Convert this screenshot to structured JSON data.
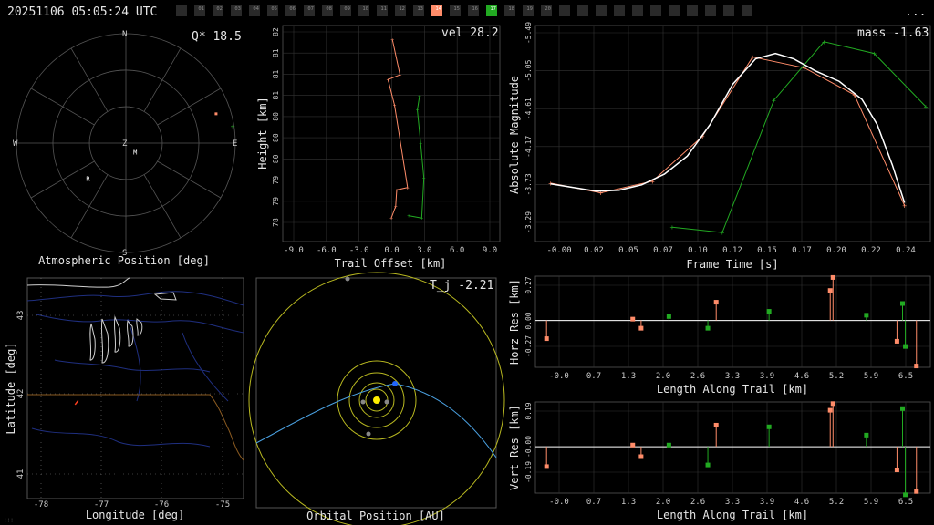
{
  "header": {
    "timestamp": "20251106 05:05:24 UTC",
    "menu_label": "...",
    "stations": [
      {
        "label": "",
        "state": "off"
      },
      {
        "label": "01",
        "state": "off"
      },
      {
        "label": "02",
        "state": "off"
      },
      {
        "label": "03",
        "state": "off"
      },
      {
        "label": "04",
        "state": "off"
      },
      {
        "label": "05",
        "state": "off"
      },
      {
        "label": "06",
        "state": "off"
      },
      {
        "label": "07",
        "state": "off"
      },
      {
        "label": "08",
        "state": "off"
      },
      {
        "label": "09",
        "state": "off"
      },
      {
        "label": "10",
        "state": "off"
      },
      {
        "label": "11",
        "state": "off"
      },
      {
        "label": "12",
        "state": "off"
      },
      {
        "label": "13",
        "state": "off"
      },
      {
        "label": "14",
        "state": "active-orange"
      },
      {
        "label": "15",
        "state": "off"
      },
      {
        "label": "16",
        "state": "off"
      },
      {
        "label": "17",
        "state": "active-green"
      },
      {
        "label": "18",
        "state": "off"
      },
      {
        "label": "19",
        "state": "off"
      },
      {
        "label": "20",
        "state": "off"
      },
      {
        "label": "",
        "state": "off"
      },
      {
        "label": "",
        "state": "off"
      },
      {
        "label": "",
        "state": "off"
      },
      {
        "label": "",
        "state": "off"
      },
      {
        "label": "",
        "state": "off"
      },
      {
        "label": "",
        "state": "off"
      },
      {
        "label": "",
        "state": "off"
      },
      {
        "label": "",
        "state": "off"
      },
      {
        "label": "",
        "state": "off"
      },
      {
        "label": "",
        "state": "off"
      },
      {
        "label": "",
        "state": "off"
      }
    ]
  },
  "colors": {
    "orange": "#ff8c69",
    "green": "#22aa22",
    "white": "#ffffff",
    "grid": "#333333",
    "sun": "#ffee00",
    "orbit": "#b8b820",
    "meteor_orbit": "#4aa0e0"
  },
  "chart_data": [
    {
      "id": "polar",
      "type": "scatter",
      "title": "",
      "stat_label": "Q* 18.5",
      "xlabel": "Atmospheric Position [deg]",
      "compass": {
        "n": "N",
        "s": "S",
        "e": "E",
        "w": "W",
        "z": "Z"
      },
      "markers": [
        {
          "label": "R",
          "az_deg": 225,
          "zen_deg": 44
        },
        {
          "label": "M",
          "az_deg": 140,
          "zen_deg": 12
        }
      ],
      "series": [
        {
          "color": "orange",
          "points": [
            {
              "az_deg": 72,
              "zen_deg": 78
            }
          ]
        },
        {
          "color": "green",
          "points": [
            {
              "az_deg": 81,
              "zen_deg": 89
            }
          ]
        }
      ]
    },
    {
      "id": "trail",
      "type": "line",
      "stat_label": "vel 28.2",
      "xlabel": "Trail Offset [km]",
      "ylabel": "Height [km]",
      "x_ticks": [
        "-9.0",
        "-6.0",
        "-3.0",
        "0.0",
        "3.0",
        "6.0",
        "9.0"
      ],
      "y_ticks": [
        "78",
        "79",
        "79",
        "80",
        "80",
        "80",
        "81",
        "81",
        "81",
        "82"
      ],
      "xlim": [
        -10,
        10
      ],
      "ylim": [
        77.7,
        82.3
      ],
      "series": [
        {
          "color": "orange",
          "points": [
            [
              0.1,
              82.0
            ],
            [
              0.8,
              81.25
            ],
            [
              -0.3,
              81.15
            ],
            [
              0.3,
              80.6
            ],
            [
              1.5,
              78.85
            ],
            [
              0.5,
              78.8
            ],
            [
              0.4,
              78.45
            ],
            [
              0.0,
              78.2
            ]
          ]
        },
        {
          "color": "green",
          "points": [
            [
              2.6,
              80.8
            ],
            [
              2.4,
              80.5
            ],
            [
              2.7,
              79.8
            ],
            [
              3.0,
              79.05
            ],
            [
              2.8,
              78.2
            ],
            [
              1.6,
              78.25
            ]
          ]
        }
      ]
    },
    {
      "id": "mag",
      "type": "line",
      "stat_label": "mass -1.63",
      "xlabel": "Frame Time [s]",
      "ylabel": "Absolute Magnitude",
      "x_ticks": [
        "-0.00",
        "0.02",
        "0.05",
        "0.07",
        "0.10",
        "0.12",
        "0.15",
        "0.17",
        "0.20",
        "0.22",
        "0.24"
      ],
      "y_ticks": [
        "-5.49",
        "-5.05",
        "-4.61",
        "-4.17",
        "-3.73",
        "-3.29"
      ],
      "xlim": [
        -0.01,
        0.25
      ],
      "ylim": [
        -3.15,
        -5.55
      ],
      "series": [
        {
          "color": "orange",
          "points": [
            [
              0.0,
              -3.8
            ],
            [
              0.033,
              -3.69
            ],
            [
              0.067,
              -3.82
            ],
            [
              0.1,
              -4.32
            ],
            [
              0.133,
              -5.2
            ],
            [
              0.167,
              -5.08
            ],
            [
              0.2,
              -4.78
            ],
            [
              0.233,
              -3.55
            ]
          ]
        },
        {
          "color": "green",
          "points": [
            [
              0.08,
              -3.31
            ],
            [
              0.113,
              -3.25
            ],
            [
              0.147,
              -4.72
            ],
            [
              0.18,
              -5.37
            ],
            [
              0.213,
              -5.24
            ],
            [
              0.247,
              -4.65
            ]
          ]
        },
        {
          "color": "white",
          "smooth": true,
          "points": [
            [
              0.0,
              -3.79
            ],
            [
              0.015,
              -3.75
            ],
            [
              0.03,
              -3.71
            ],
            [
              0.045,
              -3.72
            ],
            [
              0.06,
              -3.78
            ],
            [
              0.075,
              -3.9
            ],
            [
              0.09,
              -4.1
            ],
            [
              0.105,
              -4.45
            ],
            [
              0.12,
              -4.9
            ],
            [
              0.135,
              -5.18
            ],
            [
              0.148,
              -5.24
            ],
            [
              0.16,
              -5.18
            ],
            [
              0.175,
              -5.04
            ],
            [
              0.19,
              -4.93
            ],
            [
              0.205,
              -4.73
            ],
            [
              0.215,
              -4.45
            ],
            [
              0.225,
              -4.0
            ],
            [
              0.233,
              -3.58
            ]
          ]
        }
      ]
    },
    {
      "id": "horz",
      "type": "scatter",
      "xlabel": "Length Along Trail [km]",
      "ylabel": "Horz Res [km]",
      "x_ticks": [
        "-0.0",
        "0.7",
        "1.3",
        "2.0",
        "2.6",
        "3.3",
        "3.9",
        "4.6",
        "5.2",
        "5.9",
        "6.5"
      ],
      "y_ticks": [
        "0.27",
        "0.00",
        "-0.27"
      ],
      "xlim": [
        -0.2,
        6.9
      ],
      "ylim": [
        -0.36,
        0.34
      ],
      "series": [
        {
          "color": "orange",
          "points": [
            [
              0.0,
              -0.14
            ],
            [
              1.55,
              0.01
            ],
            [
              1.7,
              -0.06
            ],
            [
              3.05,
              0.14
            ],
            [
              5.1,
              0.23
            ],
            [
              5.15,
              0.33
            ],
            [
              6.3,
              -0.16
            ],
            [
              6.65,
              -0.35
            ]
          ]
        },
        {
          "color": "green",
          "points": [
            [
              2.2,
              0.03
            ],
            [
              2.9,
              -0.06
            ],
            [
              4.0,
              0.07
            ],
            [
              5.75,
              0.04
            ],
            [
              6.4,
              0.13
            ],
            [
              6.45,
              -0.2
            ]
          ]
        }
      ]
    },
    {
      "id": "vert",
      "type": "scatter",
      "xlabel": "Length Along Trail [km]",
      "ylabel": "Vert Res [km]",
      "x_ticks": [
        "-0.0",
        "0.7",
        "1.3",
        "2.0",
        "2.6",
        "3.3",
        "3.9",
        "4.6",
        "5.2",
        "5.9",
        "6.5"
      ],
      "y_ticks": [
        "0.19",
        "-0.00",
        "-0.19"
      ],
      "xlim": [
        -0.2,
        6.9
      ],
      "ylim": [
        -0.28,
        0.27
      ],
      "series": [
        {
          "color": "orange",
          "points": [
            [
              0.0,
              -0.12
            ],
            [
              1.55,
              0.01
            ],
            [
              1.7,
              -0.06
            ],
            [
              3.05,
              0.13
            ],
            [
              5.1,
              0.22
            ],
            [
              5.15,
              0.26
            ],
            [
              6.3,
              -0.14
            ],
            [
              6.65,
              -0.27
            ]
          ]
        },
        {
          "color": "green",
          "points": [
            [
              2.2,
              0.01
            ],
            [
              2.9,
              -0.11
            ],
            [
              4.0,
              0.12
            ],
            [
              5.75,
              0.07
            ],
            [
              6.4,
              0.23
            ],
            [
              6.45,
              -0.29
            ]
          ]
        }
      ]
    },
    {
      "id": "orbit",
      "type": "scatter",
      "stat_label": "T_j -2.21",
      "xlabel": "Orbital Position [AU]"
    },
    {
      "id": "map",
      "type": "scatter",
      "xlabel": "Longitude [deg]",
      "ylabel": "Latitude [deg]",
      "x_ticks": [
        "-78",
        "-77",
        "-76",
        "-75"
      ],
      "y_ticks": [
        "43",
        "42",
        "41"
      ],
      "xlim": [
        -78.2,
        -74.8
      ],
      "ylim": [
        40.8,
        43.5
      ],
      "meteor_track": [
        [
          -77.4,
          42.0
        ],
        [
          -77.45,
          41.95
        ]
      ]
    }
  ],
  "footer": {
    "corner_label": "!!!"
  }
}
